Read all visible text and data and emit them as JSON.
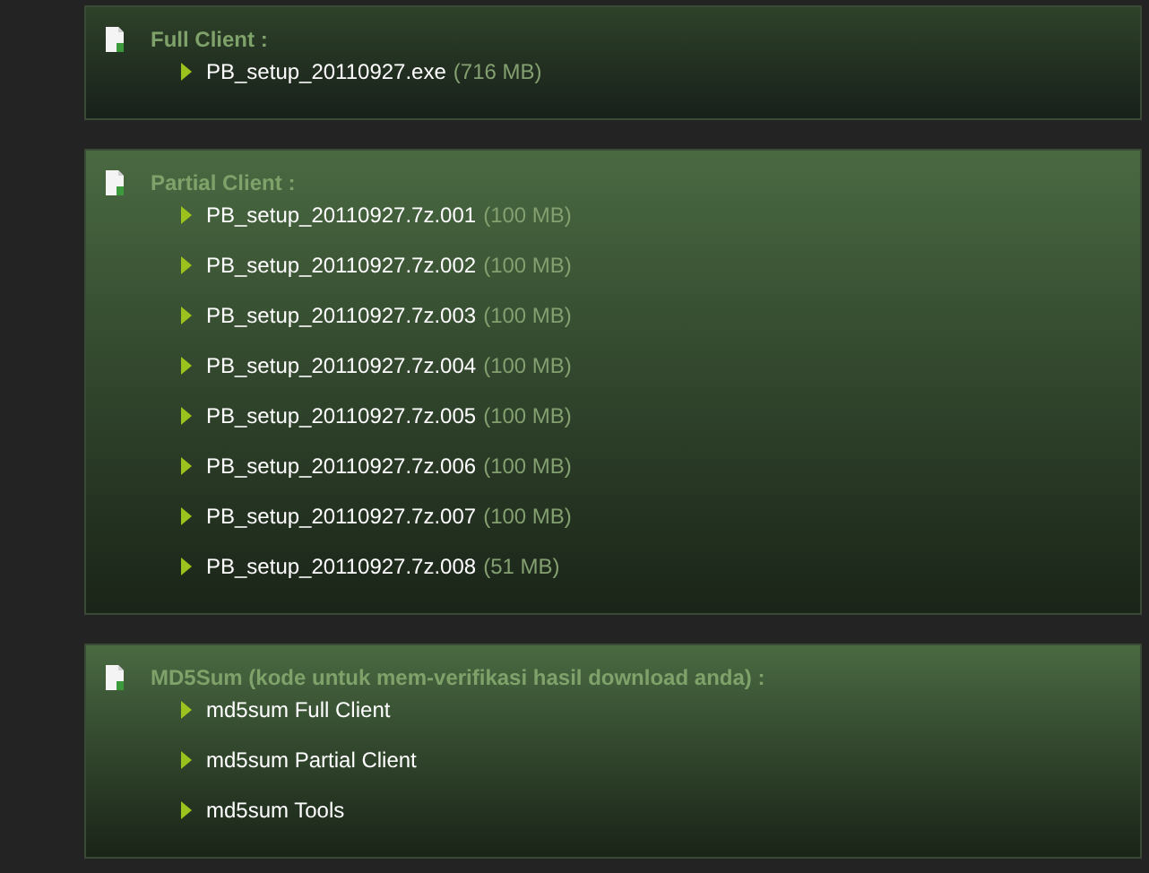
{
  "sections": [
    {
      "title": "Full Client :",
      "items": [
        {
          "name": "PB_setup_20110927.exe",
          "size": "(716 MB)"
        }
      ]
    },
    {
      "title": "Partial Client :",
      "items": [
        {
          "name": "PB_setup_20110927.7z.001",
          "size": "(100 MB)"
        },
        {
          "name": "PB_setup_20110927.7z.002",
          "size": "(100 MB)"
        },
        {
          "name": "PB_setup_20110927.7z.003",
          "size": "(100 MB)"
        },
        {
          "name": "PB_setup_20110927.7z.004",
          "size": "(100 MB)"
        },
        {
          "name": "PB_setup_20110927.7z.005",
          "size": "(100 MB)"
        },
        {
          "name": "PB_setup_20110927.7z.006",
          "size": "(100 MB)"
        },
        {
          "name": "PB_setup_20110927.7z.007",
          "size": "(100 MB)"
        },
        {
          "name": "PB_setup_20110927.7z.008",
          "size": "(51 MB)"
        }
      ]
    },
    {
      "title": "MD5Sum (kode untuk mem-verifikasi hasil download anda) :",
      "items": [
        {
          "name": "md5sum Full Client"
        },
        {
          "name": "md5sum Partial Client"
        },
        {
          "name": "md5sum Tools"
        }
      ]
    }
  ]
}
